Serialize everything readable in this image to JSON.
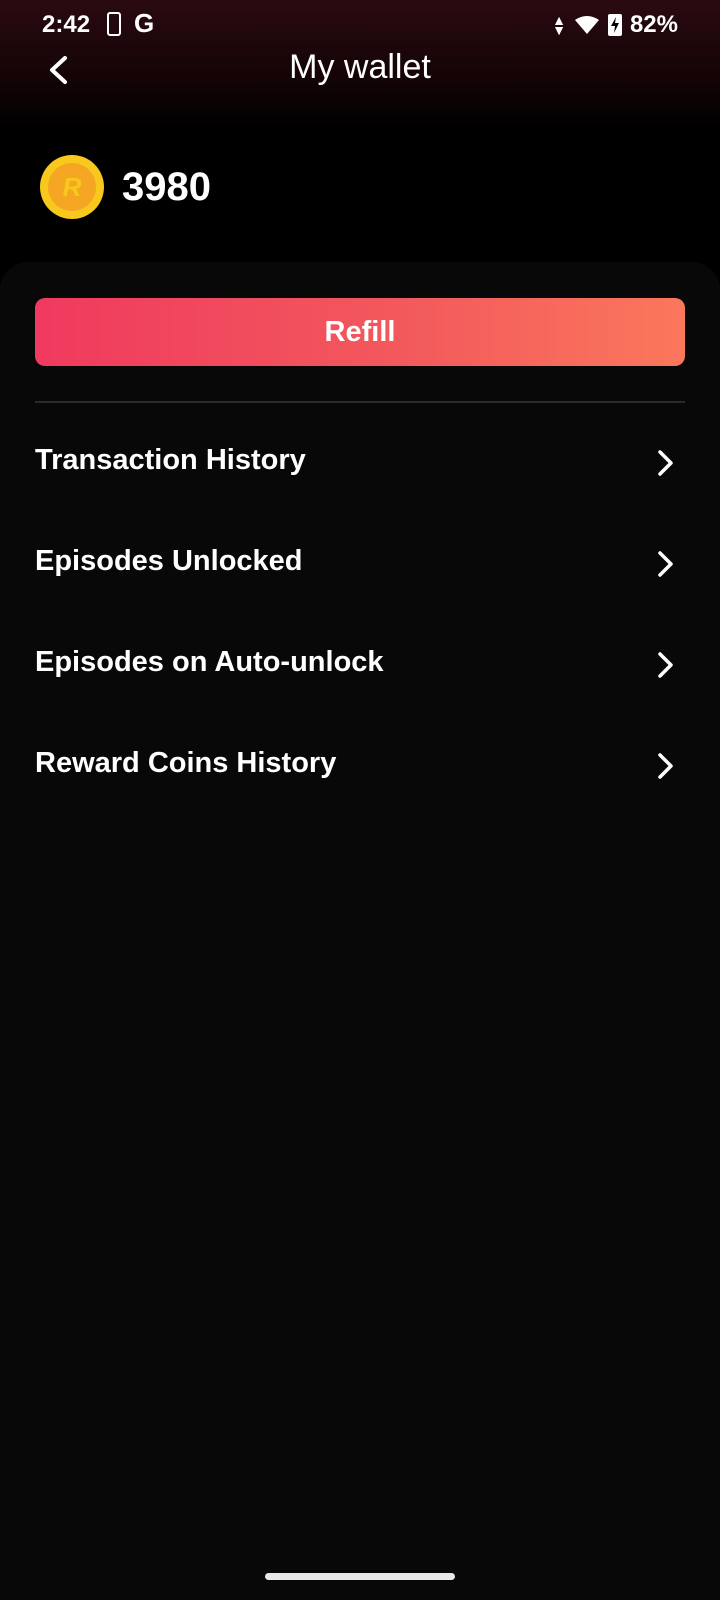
{
  "status_bar": {
    "time": "2:42",
    "carrier_icon": "G",
    "battery": "82%",
    "icons": [
      "phone-icon",
      "g-icon",
      "data-arrows-icon",
      "wifi-icon",
      "battery-charging-icon"
    ]
  },
  "header": {
    "title": "My wallet",
    "back_icon": "chevron-left-icon"
  },
  "balance": {
    "coin_icon": "coin-icon",
    "coin_letter": "R",
    "amount": "3980"
  },
  "refill": {
    "label": "Refill",
    "colors": [
      "#f03a5f",
      "#fb775c"
    ]
  },
  "menu": {
    "items": [
      {
        "label": "Transaction History"
      },
      {
        "label": "Episodes Unlocked"
      },
      {
        "label": "Episodes on Auto-unlock"
      },
      {
        "label": "Reward Coins History"
      }
    ]
  }
}
